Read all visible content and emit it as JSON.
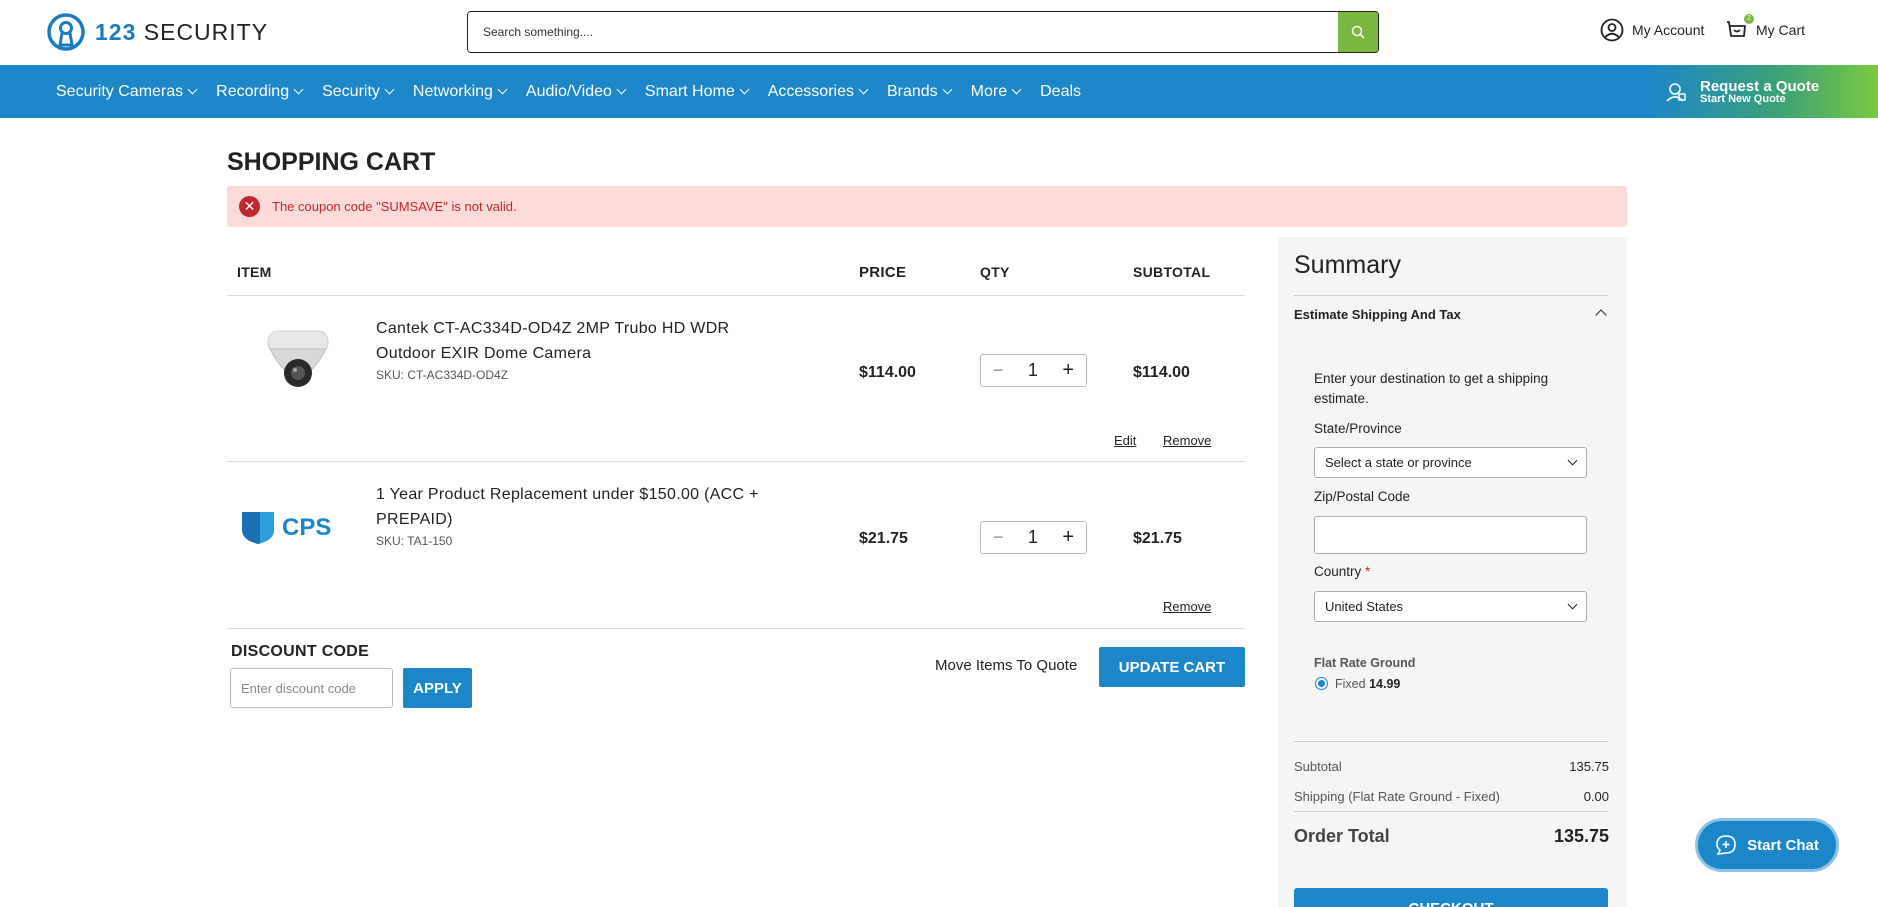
{
  "header": {
    "logo_number": "123",
    "logo_word": "SECURITY",
    "search_placeholder": "Search something....",
    "my_account": "My Account",
    "my_cart": "My Cart",
    "cart_count": "2"
  },
  "nav": {
    "items": [
      "Security Cameras",
      "Recording",
      "Security",
      "Networking",
      "Audio/Video",
      "Smart Home",
      "Accessories",
      "Brands",
      "More",
      "Deals"
    ],
    "quote_title": "Request a Quote",
    "quote_sub": "Start New Quote"
  },
  "page": {
    "title": "SHOPPING CART",
    "alert": "The coupon code \"SUMSAVE\" is not valid."
  },
  "table": {
    "headers": {
      "item": "ITEM",
      "price": "PRICE",
      "qty": "QTY",
      "subtotal": "SUBTOTAL"
    },
    "rows": [
      {
        "name": "Cantek CT-AC334D-OD4Z 2MP Trubo HD WDR Outdoor EXIR Dome Camera",
        "sku": "SKU: CT-AC334D-OD4Z",
        "price": "$114.00",
        "qty": "1",
        "subtotal": "$114.00",
        "edit": "Edit",
        "remove": "Remove"
      },
      {
        "name": "1 Year Product Replacement under $150.00 (ACC + PREPAID)",
        "sku": "SKU: TA1-150",
        "price": "$21.75",
        "qty": "1",
        "subtotal": "$21.75",
        "remove": "Remove",
        "logo_text": "CPS"
      }
    ]
  },
  "discount": {
    "label": "DISCOUNT CODE",
    "placeholder": "Enter discount code",
    "apply": "APPLY"
  },
  "actions": {
    "move_to_quote": "Move Items To Quote",
    "update_cart": "UPDATE CART"
  },
  "summary": {
    "title": "Summary",
    "estimate": "Estimate Shipping And Tax",
    "hint": "Enter your destination to get a shipping estimate.",
    "state_label": "State/Province",
    "state_value": "Select a state or province",
    "zip_label": "Zip/Postal Code",
    "country_label": "Country",
    "country_required": "*",
    "country_value": "United States",
    "shipping_method": "Flat Rate Ground",
    "fixed_label": "Fixed",
    "fixed_price": "14.99",
    "subtotal_label": "Subtotal",
    "subtotal_value": "135.75",
    "shipping_label": "Shipping (Flat Rate Ground - Fixed)",
    "shipping_value": "0.00",
    "order_total_label": "Order Total",
    "order_total_value": "135.75",
    "checkout": "CHECKOUT"
  },
  "chat": {
    "label": "Start Chat"
  },
  "colors": {
    "brand_blue": "#1b87c9",
    "brand_green": "#7ab73f",
    "error_red": "#c0262d"
  }
}
